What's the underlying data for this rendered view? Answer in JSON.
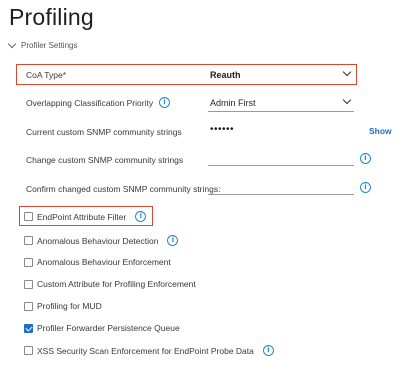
{
  "page": {
    "title": "Profiling"
  },
  "section": {
    "label": "Profiler Settings"
  },
  "fields": {
    "coa_type": {
      "label": "CoA Type*",
      "value": "Reauth"
    },
    "overlapping": {
      "label": "Overlapping Classification Priority",
      "value": "Admin First"
    },
    "current_snmp": {
      "label": "Current custom SNMP community strings",
      "value": "••••••",
      "show_label": "Show"
    },
    "change_snmp": {
      "label": "Change custom SNMP community strings",
      "value": ""
    },
    "confirm_snmp": {
      "label": "Confirm changed custom SNMP community strings:",
      "value": ""
    }
  },
  "checkboxes": [
    {
      "label": "EndPoint Attribute Filter",
      "checked": false
    },
    {
      "label": "Anomalous Behaviour Detection",
      "checked": false
    },
    {
      "label": "Anomalous Behaviour Enforcement",
      "checked": false
    },
    {
      "label": "Custom Attribute for Profiling Enforcement",
      "checked": false
    },
    {
      "label": "Profiling for MUD",
      "checked": false
    },
    {
      "label": "Profiler Forwarder Persistence Queue",
      "checked": true
    },
    {
      "label": "XSS Security Scan Enforcement for EndPoint Probe Data",
      "checked": false
    }
  ],
  "icons": {
    "info": "i"
  },
  "colors": {
    "highlight": "#d9472f",
    "accent": "#1b6fc8",
    "info": "#1b8bd0"
  }
}
